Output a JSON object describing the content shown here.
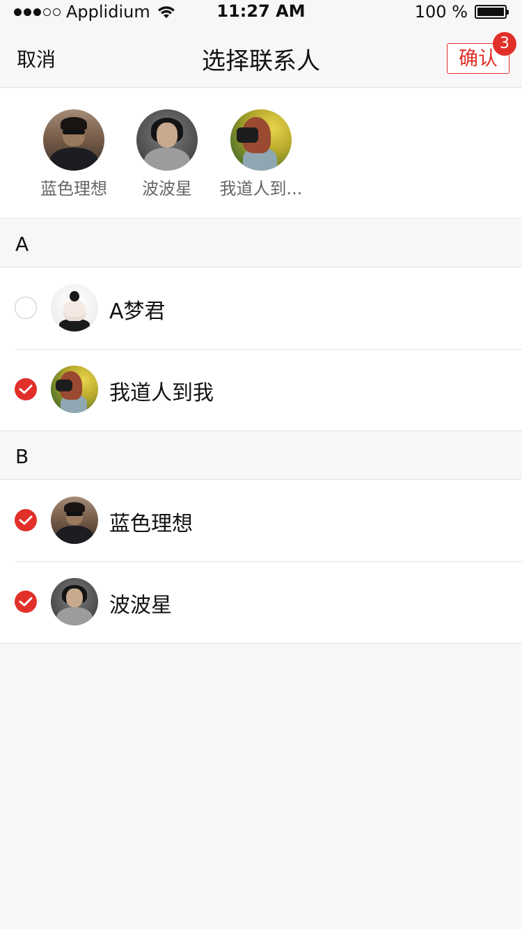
{
  "status_bar": {
    "carrier": "Applidium",
    "time": "11:27 AM",
    "battery": "100 %"
  },
  "nav": {
    "cancel_label": "取消",
    "title": "选择联系人",
    "confirm_label": "确认",
    "badge_count": "3"
  },
  "selected": [
    {
      "name": "蓝色理想",
      "avatar": "avatar-portrait-sunglasses"
    },
    {
      "name": "波波星",
      "avatar": "avatar-portrait-long-hair"
    },
    {
      "name": "我道人到...",
      "avatar": "avatar-photo-sunflowers"
    }
  ],
  "sections": [
    {
      "letter": "A",
      "contacts": [
        {
          "name": "A梦君",
          "checked": false,
          "avatar": "avatar-portrait-back"
        },
        {
          "name": "我道人到我",
          "checked": true,
          "avatar": "avatar-photo-sunflowers"
        }
      ]
    },
    {
      "letter": "B",
      "contacts": [
        {
          "name": "蓝色理想",
          "checked": true,
          "avatar": "avatar-portrait-sunglasses"
        },
        {
          "name": "波波星",
          "checked": true,
          "avatar": "avatar-portrait-long-hair"
        }
      ]
    }
  ],
  "colors": {
    "accent": "#e1302a",
    "background": "#f7f7f7",
    "divider": "#e2e2e2"
  }
}
